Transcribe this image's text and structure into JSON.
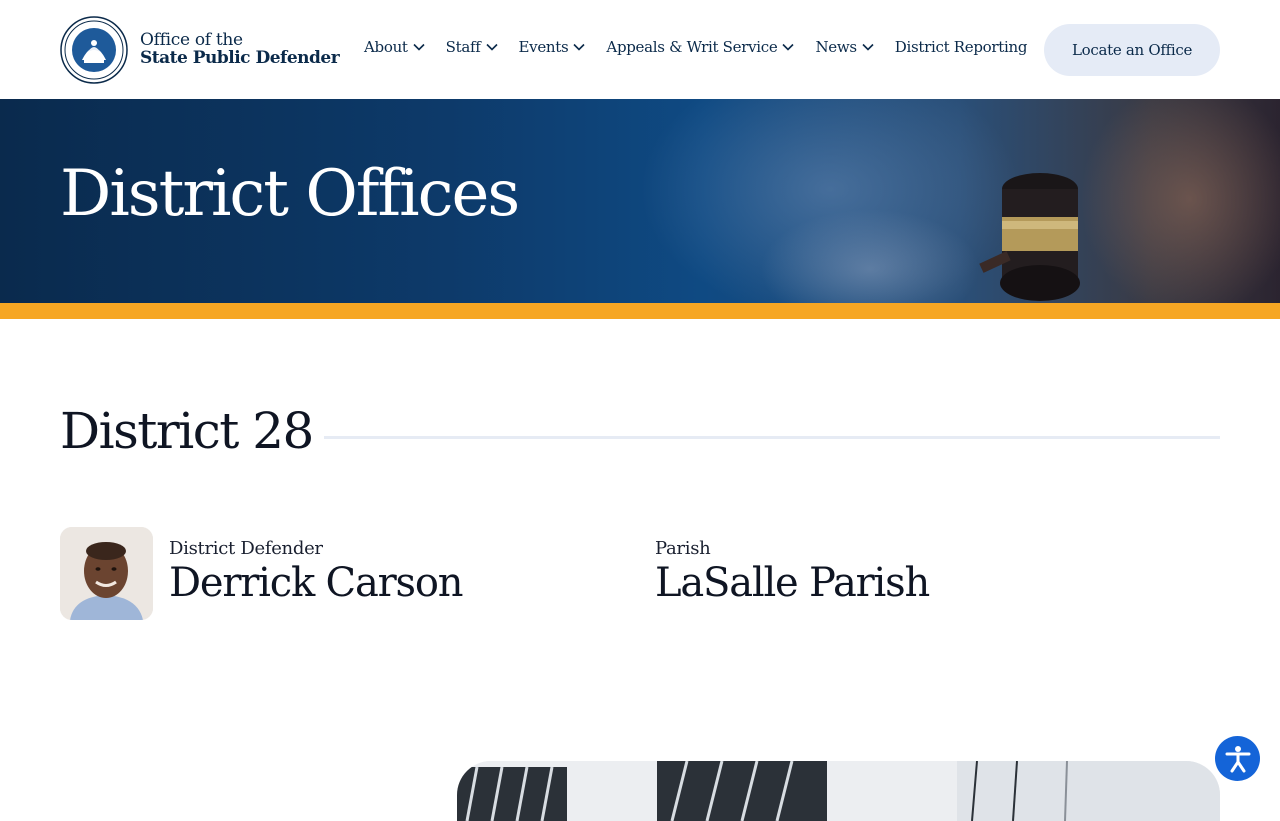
{
  "header": {
    "logo_line1": "Office of the",
    "logo_line2": "State Public Defender",
    "nav": [
      {
        "label": "About",
        "has_dropdown": true
      },
      {
        "label": "Staff",
        "has_dropdown": true
      },
      {
        "label": "Events",
        "has_dropdown": true
      },
      {
        "label": "Appeals & Writ Service",
        "has_dropdown": true
      },
      {
        "label": "News",
        "has_dropdown": true
      },
      {
        "label": "District Reporting",
        "has_dropdown": false
      }
    ],
    "cta_label": "Locate an Office"
  },
  "hero": {
    "title": "District Offices"
  },
  "district": {
    "title": "District 28",
    "defender_label": "District Defender",
    "defender_name": "Derrick Carson",
    "parish_label": "Parish",
    "parish_name": "LaSalle Parish"
  },
  "colors": {
    "navy": "#0b2a4a",
    "accent_bar": "#f6a623",
    "button_bg": "#e5ebf6",
    "a11y_blue": "#1464d8"
  },
  "icons": {
    "seal": "state-seal-icon",
    "chevron": "chevron-down-icon",
    "accessibility": "accessibility-icon"
  }
}
